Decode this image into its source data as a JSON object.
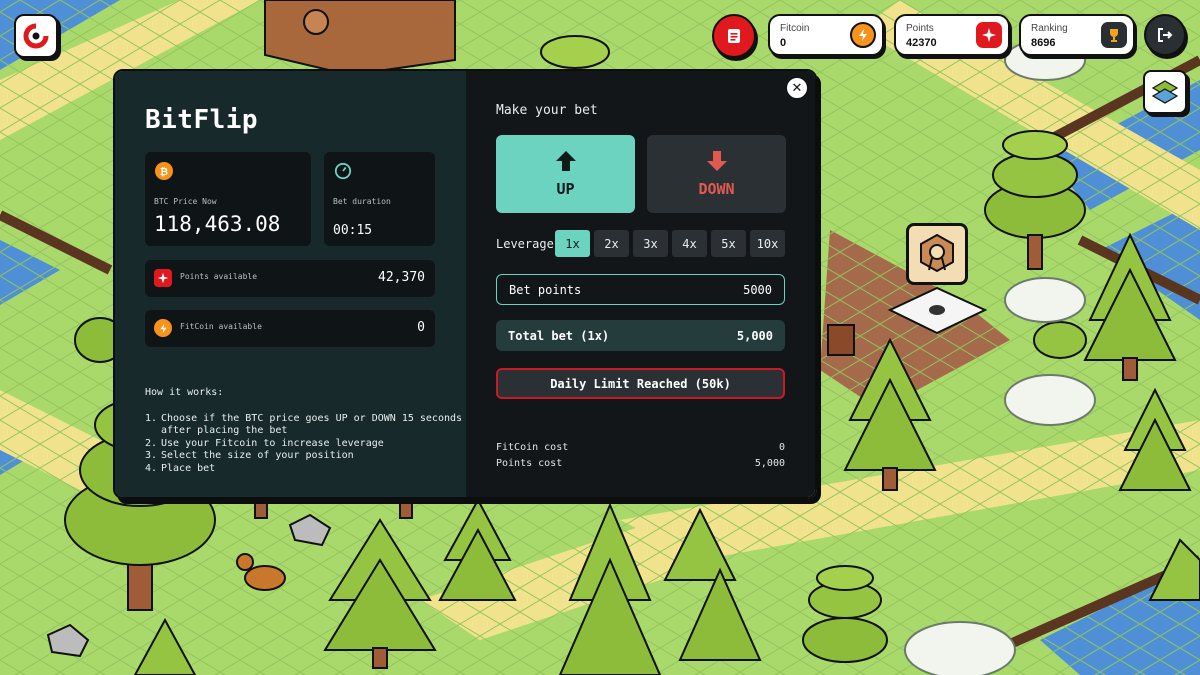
{
  "hud": {
    "fitcoin": {
      "label": "Fitcoin",
      "value": "0",
      "icon": "lightning-coin-icon"
    },
    "points": {
      "label": "Points",
      "value": "42370",
      "icon": "sparkle-icon"
    },
    "ranking": {
      "label": "Ranking",
      "value": "8696",
      "icon": "trophy-icon"
    },
    "icons": {
      "logo": "app-logo-icon",
      "activity": "clipboard-icon",
      "logout": "logout-icon",
      "map": "map-icon"
    }
  },
  "modal": {
    "title": "BitFlip",
    "close_icon": "close-icon",
    "price": {
      "label": "BTC Price Now",
      "value": "118,463.08",
      "icon": "bitcoin-icon"
    },
    "duration": {
      "label": "Bet duration",
      "value": "00:15",
      "icon": "timer-icon"
    },
    "points_available": {
      "label": "Points available",
      "value": "42,370"
    },
    "fitcoin_available": {
      "label": "FitCoin available",
      "value": "0"
    },
    "how": {
      "title": "How it works:",
      "steps": [
        {
          "n": "1.",
          "text": "Choose if the BTC price goes UP or DOWN 15 seconds after placing the bet"
        },
        {
          "n": "2.",
          "text": "Use your Fitcoin to increase leverage"
        },
        {
          "n": "3.",
          "text": "Select the size of your position"
        },
        {
          "n": "4.",
          "text": "Place bet"
        }
      ]
    },
    "bet": {
      "title": "Make your bet",
      "up_label": "UP",
      "down_label": "DOWN",
      "leverage_label": "Leverage",
      "leverage_options": [
        "1x",
        "2x",
        "3x",
        "4x",
        "5x",
        "10x"
      ],
      "leverage_selected": "1x",
      "bet_points_label": "Bet points",
      "bet_points_value": "5000",
      "total_label": "Total bet (1x)",
      "total_value": "5,000",
      "limit_label": "Daily Limit Reached (50k)",
      "fitcoin_cost_label": "FitCoin cost",
      "fitcoin_cost_value": "0",
      "points_cost_label": "Points cost",
      "points_cost_value": "5,000"
    }
  },
  "colors": {
    "accent": "#6bd3c0",
    "danger": "#c81c22",
    "down": "#e05a50",
    "bitcoin": "#f7931a",
    "points": "#e0191f",
    "left_panel": "#17292b",
    "right_panel": "#121619",
    "grass": "#a9d96b"
  }
}
